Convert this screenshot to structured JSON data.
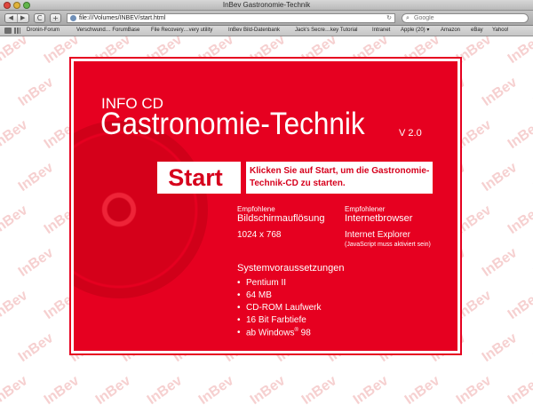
{
  "window": {
    "title": "InBev Gastronomie-Technik"
  },
  "toolbar": {
    "back_label": "◀",
    "forward_label": "▶",
    "reload_label": "C",
    "add_label": "+",
    "address": "file:///Volumes/INBEV/start.html",
    "search_placeholder": "Google"
  },
  "bookmarks": [
    "Dronin-Forum",
    "Verschwund… ForumBase",
    "File Recovery…very utility",
    "InBev Bild-Datenbank",
    "Jack's Secre…key Tutorial",
    "Intranet",
    "Apple (20) ▾",
    "Amazon",
    "eBay",
    "Yahoo!"
  ],
  "watermark_text": "InBev",
  "page": {
    "subtitle": "INFO CD",
    "title": "Gastronomie-Technik",
    "version": "V 2.0",
    "start_label": "Start",
    "start_hint": "Klicken Sie auf Start, um die Gastronomie-Technik-CD zu starten.",
    "resolution": {
      "label_top": "Empfohlene",
      "label": "Bildschirmauflösung",
      "value": "1024 x 768"
    },
    "browser": {
      "label_top": "Empfohlener",
      "label": "Internetbrowser",
      "value": "Internet Explorer",
      "note": "(JavaScript muss aktiviert sein)"
    },
    "requirements": {
      "heading": "Systemvoraussetzungen",
      "items": [
        "Pentium II",
        "64 MB",
        "CD-ROM Laufwerk",
        "16 Bit Farbtiefe"
      ],
      "windows_prefix": "ab Windows",
      "windows_mark": "®",
      "windows_version": "98"
    }
  },
  "colors": {
    "brand_red": "#e60020",
    "text_red": "#d6001c"
  }
}
